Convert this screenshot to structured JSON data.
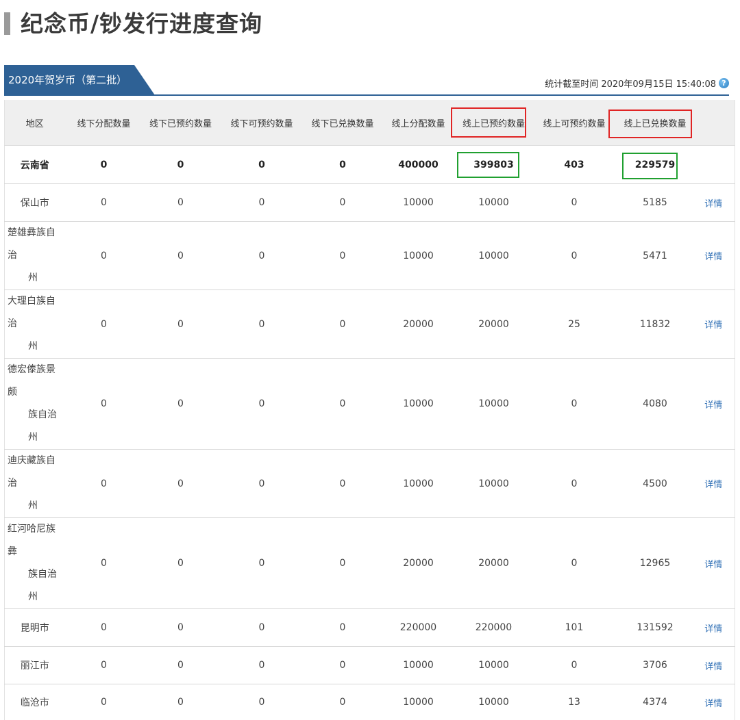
{
  "page": {
    "title": "纪念币/钞发行进度查询"
  },
  "batch_tab": {
    "label": "2020年贺岁币（第二批）"
  },
  "stat_time": {
    "label": "统计截至时间",
    "value": "2020年09月15日 15:40:08",
    "icon": "question-circle-icon"
  },
  "table": {
    "columns": [
      "地区",
      "线下分配数量",
      "线下已预约数量",
      "线下可预约数量",
      "线下已兑换数量",
      "线上分配数量",
      "线上已预约数量",
      "线上可预约数量",
      "线上已兑换数量",
      ""
    ],
    "province": {
      "region": "云南省",
      "values": [
        "0",
        "0",
        "0",
        "0",
        "400000",
        "399803",
        "403",
        "229579"
      ]
    },
    "rows": [
      {
        "region": "保山市",
        "values": [
          "0",
          "0",
          "0",
          "0",
          "10000",
          "10000",
          "0",
          "5185"
        ],
        "link": "详情"
      },
      {
        "region": "楚雄彝族自治州",
        "region_line1": "楚雄彝族自治",
        "region_line2": "州",
        "values": [
          "0",
          "0",
          "0",
          "0",
          "10000",
          "10000",
          "0",
          "5471"
        ],
        "link": "详情"
      },
      {
        "region": "大理白族自治州",
        "region_line1": "大理白族自治",
        "region_line2": "州",
        "values": [
          "0",
          "0",
          "0",
          "0",
          "20000",
          "20000",
          "25",
          "11832"
        ],
        "link": "详情"
      },
      {
        "region": "德宏傣族景颇族自治州",
        "region_line1": "德宏傣族景颇",
        "region_line2": "族自治州",
        "values": [
          "0",
          "0",
          "0",
          "0",
          "10000",
          "10000",
          "0",
          "4080"
        ],
        "link": "详情"
      },
      {
        "region": "迪庆藏族自治州",
        "region_line1": "迪庆藏族自治",
        "region_line2": "州",
        "values": [
          "0",
          "0",
          "0",
          "0",
          "10000",
          "10000",
          "0",
          "4500"
        ],
        "link": "详情"
      },
      {
        "region": "红河哈尼族彝族自治州",
        "region_line1": "红河哈尼族彝",
        "region_line2": "族自治州",
        "values": [
          "0",
          "0",
          "0",
          "0",
          "20000",
          "20000",
          "0",
          "12965"
        ],
        "link": "详情"
      },
      {
        "region": "昆明市",
        "values": [
          "0",
          "0",
          "0",
          "0",
          "220000",
          "220000",
          "101",
          "131592"
        ],
        "link": "详情"
      },
      {
        "region": "丽江市",
        "values": [
          "0",
          "0",
          "0",
          "0",
          "10000",
          "10000",
          "0",
          "3706"
        ],
        "link": "详情"
      },
      {
        "region": "临沧市",
        "values": [
          "0",
          "0",
          "0",
          "0",
          "10000",
          "10000",
          "13",
          "4374"
        ],
        "link": "详情"
      }
    ]
  },
  "colors": {
    "tab_blue": "#2e6195",
    "header_bg": "#efefef",
    "highlight_red": "#e02424",
    "highlight_green": "#20a030",
    "link": "#2f6fb5"
  }
}
